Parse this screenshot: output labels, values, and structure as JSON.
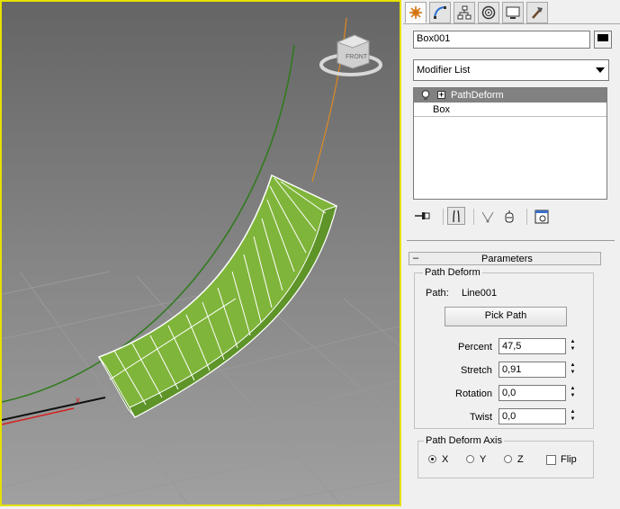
{
  "viewport": {
    "viewcube_face": "FRONT",
    "axis_label": "x"
  },
  "command_panel": {
    "tabs": [
      {
        "name": "create-icon",
        "active": true
      },
      {
        "name": "modify-icon",
        "active": false
      },
      {
        "name": "hierarchy-icon",
        "active": false
      },
      {
        "name": "motion-icon",
        "active": false
      },
      {
        "name": "display-icon",
        "active": false
      },
      {
        "name": "utilities-icon",
        "active": false
      }
    ],
    "object_name": "Box001",
    "object_color": "#000000",
    "modifier_list": "Modifier List",
    "stack": [
      {
        "label": "PathDeform",
        "selected": true
      },
      {
        "label": "Box",
        "selected": false
      }
    ],
    "stack_tools": [
      "pin-stack-icon",
      "show-end-result-icon",
      "make-unique-icon",
      "remove-modifier-icon",
      "configure-modifier-sets-icon"
    ]
  },
  "parameters": {
    "rollout_title": "Parameters",
    "collapse_glyph": "–",
    "group_title": "Path Deform",
    "path_label": "Path:",
    "path_value": "Line001",
    "pick_path_label": "Pick Path",
    "percent_label": "Percent",
    "percent_value": "47,5",
    "stretch_label": "Stretch",
    "stretch_value": "0,91",
    "rotation_label": "Rotation",
    "rotation_value": "0,0",
    "twist_label": "Twist",
    "twist_value": "0,0",
    "axis_group_title": "Path Deform Axis",
    "axis_options": [
      "X",
      "Y",
      "Z"
    ],
    "axis_selected": "X",
    "flip_label": "Flip",
    "flip_checked": false
  }
}
